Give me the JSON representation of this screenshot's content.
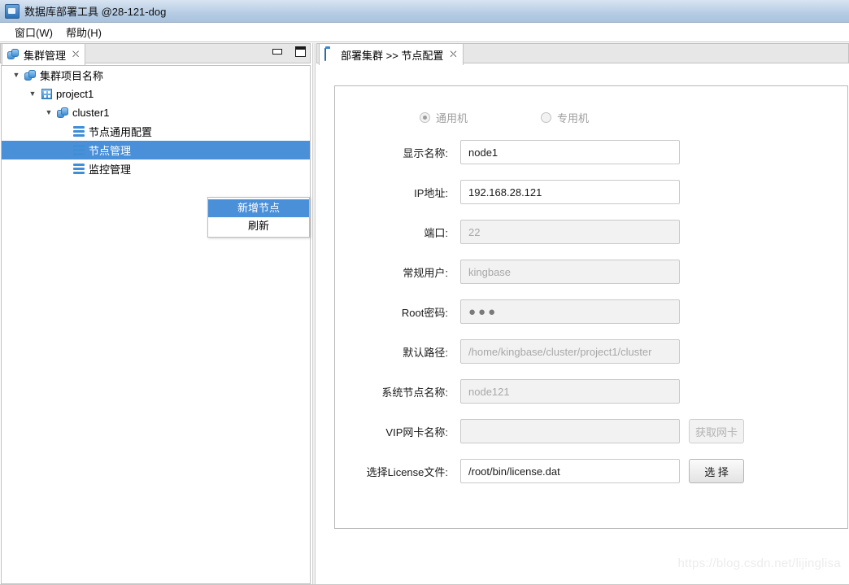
{
  "window": {
    "title": "数据库部署工具 @28-121-dog",
    "icon": "app-icon"
  },
  "menubar": {
    "items": [
      {
        "label": "窗口(W)"
      },
      {
        "label": "帮助(H)"
      }
    ]
  },
  "left_view": {
    "tab": {
      "label": "集群管理",
      "icon": "cluster-icon",
      "close_glyph": "⛌"
    },
    "window_buttons": {
      "minimize": "minimize-icon",
      "maximize": "maximize-icon"
    },
    "tree": [
      {
        "label": "集群项目名称",
        "icon": "cluster-icon",
        "twisty": "▼",
        "indent": 0,
        "selected": false
      },
      {
        "label": "project1",
        "icon": "project-icon",
        "twisty": "▼",
        "indent": 1,
        "selected": false
      },
      {
        "label": "cluster1",
        "icon": "cluster-icon",
        "twisty": "▼",
        "indent": 2,
        "selected": false
      },
      {
        "label": "节点通用配置",
        "icon": "db-icon",
        "twisty": "",
        "indent": 3,
        "selected": false
      },
      {
        "label": "节点管理",
        "icon": "db-icon",
        "twisty": "",
        "indent": 3,
        "selected": true
      },
      {
        "label": "监控管理",
        "icon": "db-icon",
        "twisty": "",
        "indent": 3,
        "selected": false
      }
    ],
    "context_menu": {
      "items": [
        {
          "label": "新增节点",
          "active": true
        },
        {
          "label": "刷新",
          "active": false
        }
      ]
    }
  },
  "right_view": {
    "tab": {
      "label": "部署集群 >> 节点配置",
      "icon": "folder-icon",
      "close_glyph": "⛌"
    },
    "machine_type": {
      "options": [
        {
          "label": "通用机",
          "checked": true
        },
        {
          "label": "专用机",
          "checked": false
        }
      ]
    },
    "fields": [
      {
        "label": "显示名称:",
        "value": "node1",
        "placeholder": "",
        "disabled": false,
        "type": "text",
        "button": null
      },
      {
        "label": "IP地址:",
        "value": "192.168.28.121",
        "placeholder": "",
        "disabled": false,
        "type": "text",
        "button": null
      },
      {
        "label": "端口:",
        "value": "22",
        "placeholder": "22",
        "disabled": true,
        "type": "text",
        "button": null
      },
      {
        "label": "常规用户:",
        "value": "kingbase",
        "placeholder": "kingbase",
        "disabled": true,
        "type": "text",
        "button": null
      },
      {
        "label": "Root密码:",
        "value": "●●●",
        "placeholder": "",
        "disabled": true,
        "type": "password",
        "button": null
      },
      {
        "label": "默认路径:",
        "value": "/home/kingbase/cluster/project1/cluster",
        "placeholder": "",
        "disabled": true,
        "type": "text",
        "button": null
      },
      {
        "label": "系统节点名称:",
        "value": "node121",
        "placeholder": "",
        "disabled": true,
        "type": "text",
        "button": null
      },
      {
        "label": "VIP网卡名称:",
        "value": "",
        "placeholder": "",
        "disabled": true,
        "type": "text",
        "button": {
          "label": "获取网卡",
          "disabled": true,
          "spaced": false
        }
      },
      {
        "label": "选择License文件:",
        "value": "/root/bin/license.dat",
        "placeholder": "",
        "disabled": false,
        "type": "text",
        "button": {
          "label": "选 择",
          "disabled": false,
          "spaced": true
        }
      }
    ]
  },
  "watermark": "https://blog.csdn.net/lijinglisa",
  "colors": {
    "accent": "#4a90d9",
    "titlebar_top": "#d8e4f2",
    "titlebar_bottom": "#a9c2dd",
    "tab_inactive": "#e7e7e7",
    "border": "#c2c2c2",
    "disabled_text": "#a8a8a8"
  }
}
